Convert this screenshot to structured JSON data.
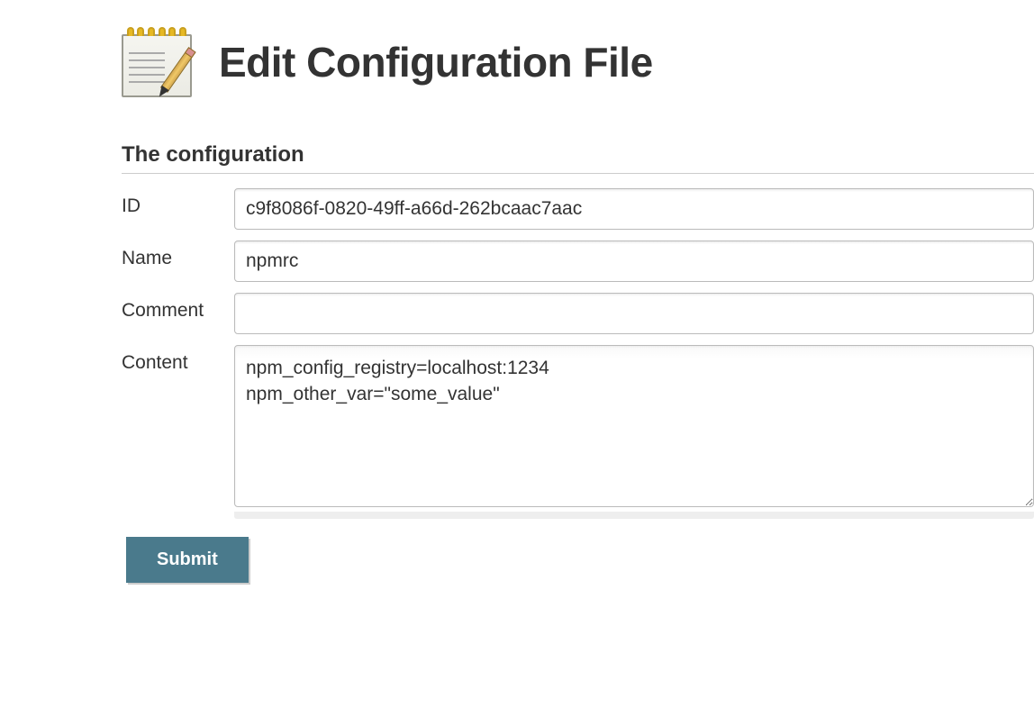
{
  "header": {
    "title": "Edit Configuration File"
  },
  "form": {
    "section_title": "The configuration",
    "fields": {
      "id": {
        "label": "ID",
        "value": "c9f8086f-0820-49ff-a66d-262bcaac7aac"
      },
      "name": {
        "label": "Name",
        "value": "npmrc"
      },
      "comment": {
        "label": "Comment",
        "value": ""
      },
      "content": {
        "label": "Content",
        "value": "npm_config_registry=localhost:1234\nnpm_other_var=\"some_value\""
      }
    },
    "submit_label": "Submit"
  }
}
